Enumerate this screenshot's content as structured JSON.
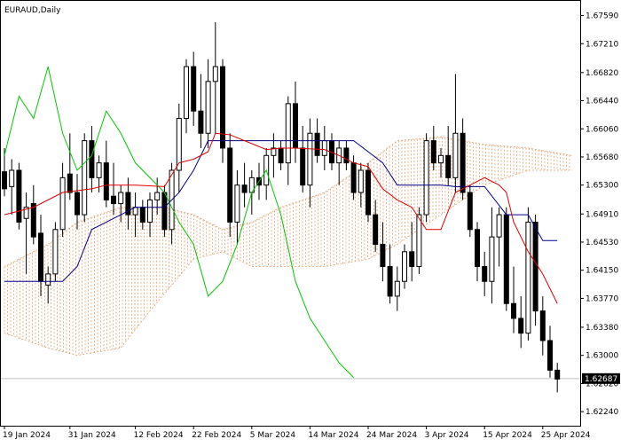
{
  "header": {
    "symbol_label": "EURAUD,Daily"
  },
  "colors": {
    "background": "#ffffff",
    "axis": "#000000",
    "candle": "#000000",
    "tenkan": "#e00000",
    "kijun": "#00008b",
    "chikou": "#00c800",
    "cloud": "#e8a070",
    "last_price_line": "#c0c0c0",
    "badge_bg": "#000000",
    "badge_text": "#ffffff"
  },
  "chart_data": {
    "type": "candlestick",
    "symbol": "EURAUD",
    "timeframe": "Daily",
    "ylim": [
      1.6205,
      1.678
    ],
    "y_ticks": [
      "1.67590",
      "1.67210",
      "1.66820",
      "1.66440",
      "1.66060",
      "1.65680",
      "1.65300",
      "1.64910",
      "1.64530",
      "1.64150",
      "1.63770",
      "1.63380",
      "1.63000",
      "1.62620",
      "1.62240"
    ],
    "x_tick_labels": [
      "19 Jan 2024",
      "31 Jan 2024",
      "12 Feb 2024",
      "22 Feb 2024",
      "5 Mar 2024",
      "14 Mar 2024",
      "24 Mar 2024",
      "3 Apr 2024",
      "15 Apr 2024",
      "25 Apr 2024"
    ],
    "x_tick_index": [
      0,
      9,
      18,
      26,
      34,
      42,
      50,
      58,
      66,
      74
    ],
    "last_price": "1.62687",
    "last_price_value": 1.62687,
    "candles": [
      [
        1.6548,
        1.658,
        1.6515,
        1.6525
      ],
      [
        1.6528,
        1.6565,
        1.649,
        1.655
      ],
      [
        1.655,
        1.656,
        1.647,
        1.648
      ],
      [
        1.6485,
        1.652,
        1.641,
        1.65
      ],
      [
        1.6505,
        1.653,
        1.645,
        1.646
      ],
      [
        1.6465,
        1.649,
        1.638,
        1.64
      ],
      [
        1.6395,
        1.642,
        1.637,
        1.641
      ],
      [
        1.641,
        1.648,
        1.64,
        1.647
      ],
      [
        1.647,
        1.656,
        1.646,
        1.654
      ],
      [
        1.6545,
        1.66,
        1.651,
        1.652
      ],
      [
        1.652,
        1.6545,
        1.647,
        1.649
      ],
      [
        1.649,
        1.66,
        1.648,
        1.659
      ],
      [
        1.659,
        1.661,
        1.652,
        1.654
      ],
      [
        1.654,
        1.657,
        1.652,
        1.656
      ],
      [
        1.656,
        1.659,
        1.65,
        1.651
      ],
      [
        1.6515,
        1.656,
        1.649,
        1.6505
      ],
      [
        1.6505,
        1.653,
        1.648,
        1.652
      ],
      [
        1.652,
        1.654,
        1.647,
        1.649
      ],
      [
        1.649,
        1.652,
        1.646,
        1.65
      ],
      [
        1.65,
        1.651,
        1.647,
        1.648
      ],
      [
        1.648,
        1.652,
        1.646,
        1.651
      ],
      [
        1.651,
        1.654,
        1.649,
        1.652
      ],
      [
        1.652,
        1.653,
        1.646,
        1.647
      ],
      [
        1.647,
        1.656,
        1.645,
        1.655
      ],
      [
        1.655,
        1.664,
        1.652,
        1.662
      ],
      [
        1.662,
        1.67,
        1.66,
        1.669
      ],
      [
        1.669,
        1.671,
        1.661,
        1.663
      ],
      [
        1.663,
        1.668,
        1.658,
        1.66
      ],
      [
        1.66,
        1.67,
        1.658,
        1.667
      ],
      [
        1.667,
        1.675,
        1.66,
        1.669
      ],
      [
        1.669,
        1.67,
        1.656,
        1.658
      ],
      [
        1.658,
        1.66,
        1.646,
        1.648
      ],
      [
        1.648,
        1.655,
        1.645,
        1.653
      ],
      [
        1.653,
        1.656,
        1.65,
        1.652
      ],
      [
        1.652,
        1.655,
        1.649,
        1.654
      ],
      [
        1.654,
        1.656,
        1.651,
        1.653
      ],
      [
        1.653,
        1.658,
        1.651,
        1.657
      ],
      [
        1.657,
        1.66,
        1.654,
        1.658
      ],
      [
        1.658,
        1.659,
        1.655,
        1.656
      ],
      [
        1.656,
        1.665,
        1.653,
        1.664
      ],
      [
        1.664,
        1.667,
        1.656,
        1.658
      ],
      [
        1.658,
        1.661,
        1.652,
        1.653
      ],
      [
        1.653,
        1.662,
        1.65,
        1.66
      ],
      [
        1.66,
        1.662,
        1.656,
        1.657
      ],
      [
        1.657,
        1.661,
        1.655,
        1.659
      ],
      [
        1.659,
        1.66,
        1.655,
        1.656
      ],
      [
        1.656,
        1.659,
        1.653,
        1.658
      ],
      [
        1.658,
        1.659,
        1.655,
        1.656
      ],
      [
        1.656,
        1.657,
        1.651,
        1.652
      ],
      [
        1.652,
        1.656,
        1.65,
        1.655
      ],
      [
        1.655,
        1.656,
        1.648,
        1.649
      ],
      [
        1.649,
        1.651,
        1.644,
        1.645
      ],
      [
        1.645,
        1.648,
        1.64,
        1.642
      ],
      [
        1.642,
        1.645,
        1.637,
        1.638
      ],
      [
        1.638,
        1.642,
        1.636,
        1.64
      ],
      [
        1.64,
        1.645,
        1.639,
        1.644
      ],
      [
        1.644,
        1.648,
        1.64,
        1.642
      ],
      [
        1.642,
        1.65,
        1.641,
        1.649
      ],
      [
        1.649,
        1.66,
        1.648,
        1.659
      ],
      [
        1.659,
        1.661,
        1.655,
        1.656
      ],
      [
        1.656,
        1.658,
        1.654,
        1.657
      ],
      [
        1.657,
        1.661,
        1.653,
        1.654
      ],
      [
        1.654,
        1.668,
        1.652,
        1.66
      ],
      [
        1.66,
        1.662,
        1.651,
        1.652
      ],
      [
        1.652,
        1.653,
        1.646,
        1.647
      ],
      [
        1.647,
        1.648,
        1.64,
        1.642
      ],
      [
        1.642,
        1.644,
        1.638,
        1.64
      ],
      [
        1.64,
        1.65,
        1.637,
        1.646
      ],
      [
        1.646,
        1.65,
        1.642,
        1.649
      ],
      [
        1.649,
        1.65,
        1.636,
        1.637
      ],
      [
        1.637,
        1.642,
        1.633,
        1.635
      ],
      [
        1.635,
        1.638,
        1.631,
        1.633
      ],
      [
        1.633,
        1.65,
        1.632,
        1.648
      ],
      [
        1.648,
        1.649,
        1.634,
        1.636
      ],
      [
        1.636,
        1.638,
        1.63,
        1.632
      ],
      [
        1.632,
        1.634,
        1.627,
        1.628
      ],
      [
        1.628,
        1.629,
        1.625,
        1.6268
      ]
    ],
    "indicators": {
      "tenkan_sen": [
        [
          0,
          1.649
        ],
        [
          4,
          1.65
        ],
        [
          8,
          1.652
        ],
        [
          12,
          1.6525
        ],
        [
          14,
          1.653
        ],
        [
          18,
          1.653
        ],
        [
          22,
          1.6528
        ],
        [
          24,
          1.656
        ],
        [
          26,
          1.6565
        ],
        [
          28,
          1.6575
        ],
        [
          29,
          1.66
        ],
        [
          31,
          1.6598
        ],
        [
          33,
          1.659
        ],
        [
          36,
          1.6578
        ],
        [
          38,
          1.658
        ],
        [
          40,
          1.658
        ],
        [
          44,
          1.6578
        ],
        [
          46,
          1.657
        ],
        [
          48,
          1.656
        ],
        [
          50,
          1.6555
        ],
        [
          52,
          1.6525
        ],
        [
          54,
          1.651
        ],
        [
          56,
          1.65
        ],
        [
          58,
          1.647
        ],
        [
          60,
          1.647
        ],
        [
          62,
          1.652
        ],
        [
          64,
          1.653
        ],
        [
          66,
          1.654
        ],
        [
          68,
          1.653
        ],
        [
          69,
          1.652
        ],
        [
          70,
          1.648
        ],
        [
          72,
          1.644
        ],
        [
          74,
          1.641
        ],
        [
          76,
          1.637
        ]
      ],
      "kijun_sen": [
        [
          0,
          1.64
        ],
        [
          8,
          1.64
        ],
        [
          10,
          1.642
        ],
        [
          12,
          1.647
        ],
        [
          18,
          1.65
        ],
        [
          22,
          1.65
        ],
        [
          24,
          1.652
        ],
        [
          26,
          1.655
        ],
        [
          28,
          1.659
        ],
        [
          36,
          1.659
        ],
        [
          44,
          1.659
        ],
        [
          48,
          1.659
        ],
        [
          52,
          1.656
        ],
        [
          54,
          1.653
        ],
        [
          58,
          1.653
        ],
        [
          60,
          1.653
        ],
        [
          62,
          1.6528
        ],
        [
          66,
          1.6528
        ],
        [
          69,
          1.649
        ],
        [
          72,
          1.649
        ],
        [
          74,
          1.6455
        ],
        [
          76,
          1.6455
        ]
      ],
      "chikou_span": [
        [
          0,
          1.657
        ],
        [
          2,
          1.665
        ],
        [
          4,
          1.662
        ],
        [
          6,
          1.669
        ],
        [
          8,
          1.66
        ],
        [
          10,
          1.655
        ],
        [
          12,
          1.657
        ],
        [
          14,
          1.663
        ],
        [
          16,
          1.66
        ],
        [
          18,
          1.656
        ],
        [
          20,
          1.654
        ],
        [
          22,
          1.652
        ],
        [
          24,
          1.648
        ],
        [
          26,
          1.645
        ],
        [
          28,
          1.638
        ],
        [
          30,
          1.64
        ],
        [
          32,
          1.645
        ],
        [
          34,
          1.652
        ],
        [
          36,
          1.655
        ],
        [
          38,
          1.649
        ],
        [
          40,
          1.64
        ],
        [
          42,
          1.635
        ],
        [
          44,
          1.632
        ],
        [
          46,
          1.629
        ],
        [
          48,
          1.627
        ]
      ],
      "kumo_span_a": [
        [
          0,
          1.642
        ],
        [
          6,
          1.645
        ],
        [
          10,
          1.648
        ],
        [
          16,
          1.65
        ],
        [
          22,
          1.65
        ],
        [
          26,
          1.649
        ],
        [
          30,
          1.647
        ],
        [
          34,
          1.648
        ],
        [
          38,
          1.65
        ],
        [
          44,
          1.652
        ],
        [
          50,
          1.656
        ],
        [
          54,
          1.659
        ],
        [
          60,
          1.6595
        ],
        [
          66,
          1.6585
        ],
        [
          72,
          1.658
        ],
        [
          78,
          1.657
        ]
      ],
      "kumo_span_b": [
        [
          0,
          1.633
        ],
        [
          6,
          1.631
        ],
        [
          10,
          1.63
        ],
        [
          16,
          1.631
        ],
        [
          20,
          1.636
        ],
        [
          26,
          1.643
        ],
        [
          30,
          1.644
        ],
        [
          34,
          1.642
        ],
        [
          38,
          1.642
        ],
        [
          44,
          1.642
        ],
        [
          50,
          1.643
        ],
        [
          54,
          1.645
        ],
        [
          60,
          1.649
        ],
        [
          66,
          1.653
        ],
        [
          72,
          1.655
        ],
        [
          78,
          1.655
        ]
      ]
    }
  }
}
